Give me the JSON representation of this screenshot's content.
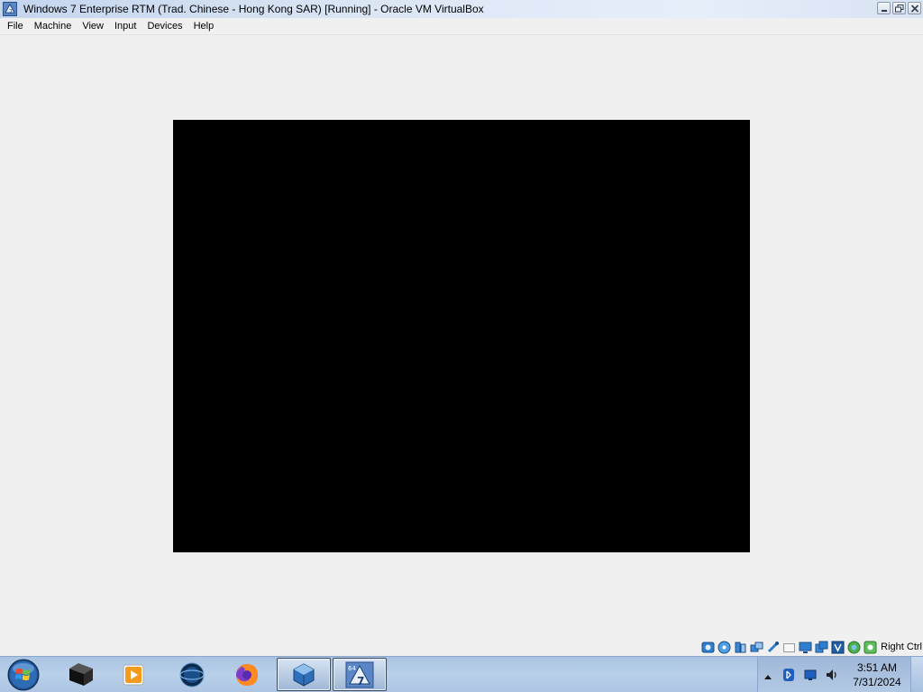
{
  "window": {
    "title": "Windows 7 Enterprise RTM (Trad. Chinese - Hong Kong SAR) [Running] - Oracle VM VirtualBox",
    "controls": [
      "minimize-icon",
      "restore-icon",
      "close-icon"
    ]
  },
  "menubar": {
    "items": [
      {
        "label": "File"
      },
      {
        "label": "Machine"
      },
      {
        "label": "View"
      },
      {
        "label": "Input"
      },
      {
        "label": "Devices"
      },
      {
        "label": "Help"
      }
    ]
  },
  "vm": {
    "screen_color": "#000000"
  },
  "statusbar": {
    "icons": [
      "hard-disk-icon",
      "optical-drive-icon",
      "audio-icon",
      "network-icon",
      "usb-icon",
      "shared-folders-icon",
      "display-icon",
      "recording-icon",
      "cpu-icon",
      "virtualization-icon",
      "mouse-integration-icon",
      "host-key-icon"
    ],
    "host_key": "Right Ctrl"
  },
  "taskbar": {
    "items": [
      {
        "icon": "start-orb-icon"
      },
      {
        "icon": "terminal-icon"
      },
      {
        "icon": "media-player-icon"
      },
      {
        "icon": "browser-globe-icon"
      },
      {
        "icon": "firefox-icon"
      },
      {
        "icon": "virtualbox-icon",
        "active": true
      },
      {
        "icon": "windows7-vm-icon",
        "active": true,
        "badge": "64"
      }
    ],
    "tray": {
      "icons": [
        "show-hidden-icons-arrow",
        "bluetooth-icon",
        "network-tray-icon",
        "volume-icon"
      ],
      "time": "3:51 AM",
      "date": "7/31/2024"
    }
  },
  "colors": {
    "taskbar": "#b3c9e4",
    "titlebar": "#dbe6f5",
    "background": "#f0f0f0"
  }
}
